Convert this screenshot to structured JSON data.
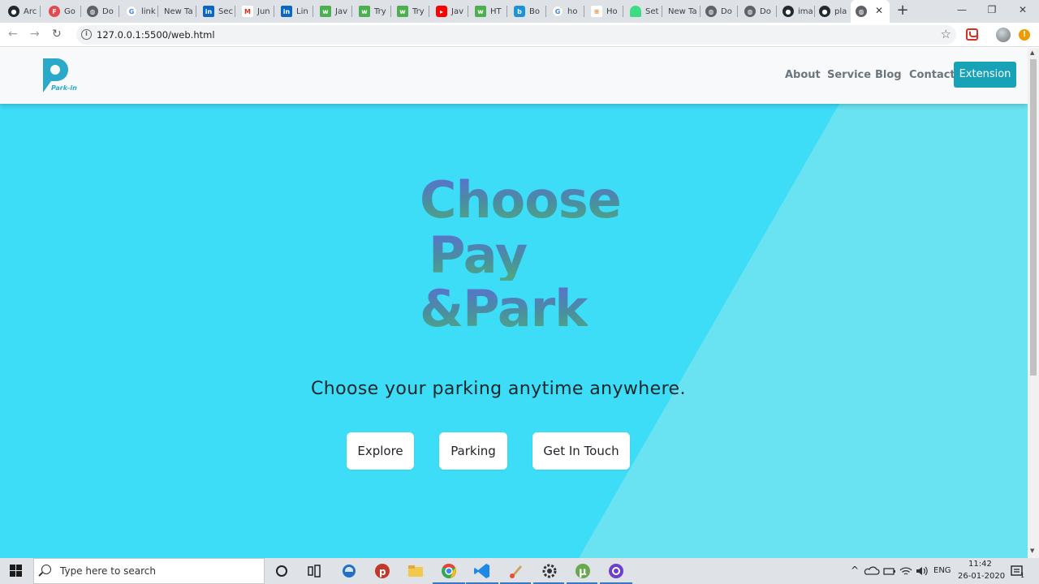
{
  "browser": {
    "tabs": [
      {
        "label": "Arc",
        "icon": "github-icon"
      },
      {
        "label": "Go",
        "icon": "f-icon"
      },
      {
        "label": "Do",
        "icon": "globe-icon"
      },
      {
        "label": "link",
        "icon": "google-icon"
      },
      {
        "label": "New Ta",
        "icon": ""
      },
      {
        "label": "Sec",
        "icon": "linkedin-icon"
      },
      {
        "label": "Jun",
        "icon": "gmail-icon"
      },
      {
        "label": "Lin",
        "icon": "linkedin-icon"
      },
      {
        "label": "Jav",
        "icon": "w3schools-icon"
      },
      {
        "label": "Try",
        "icon": "w3schools-icon"
      },
      {
        "label": "Try",
        "icon": "w3schools-icon"
      },
      {
        "label": "Jav",
        "icon": "youtube-icon"
      },
      {
        "label": "HT",
        "icon": "w3schools-icon"
      },
      {
        "label": "Bo",
        "icon": "bootstrap-icon"
      },
      {
        "label": "ho",
        "icon": "google-icon"
      },
      {
        "label": "Ho",
        "icon": "stackoverflow-icon"
      },
      {
        "label": "Set",
        "icon": "android-icon"
      },
      {
        "label": "New Ta",
        "icon": ""
      },
      {
        "label": "Do",
        "icon": "globe-icon"
      },
      {
        "label": "Do",
        "icon": "globe-icon"
      },
      {
        "label": "ima",
        "icon": "github-icon"
      },
      {
        "label": "pla",
        "icon": "github-icon"
      }
    ],
    "active_tab_close": "✕",
    "new_tab": "+",
    "url": "127.0.0.1:5500/web.html",
    "window_min": "—",
    "window_max": "❐",
    "window_close": "✕"
  },
  "site": {
    "logo_text": "Park-in",
    "nav": [
      "About",
      "Service",
      "Blog",
      "Contact"
    ],
    "cta": "Extension",
    "headline": [
      "Choose",
      "Pay",
      "&Park"
    ],
    "subtitle": "Choose your parking anytime anywhere.",
    "buttons": [
      "Explore",
      "Parking",
      "Get In Touch"
    ],
    "colors": {
      "hero": "#3ddcf7",
      "accent": "#17a2b8",
      "nav_bg": "#f8f9fa"
    }
  },
  "taskbar": {
    "search_placeholder": "Type here to search",
    "language": "ENG",
    "time": "11:42",
    "date": "26-01-2020",
    "notification_count": "1"
  }
}
